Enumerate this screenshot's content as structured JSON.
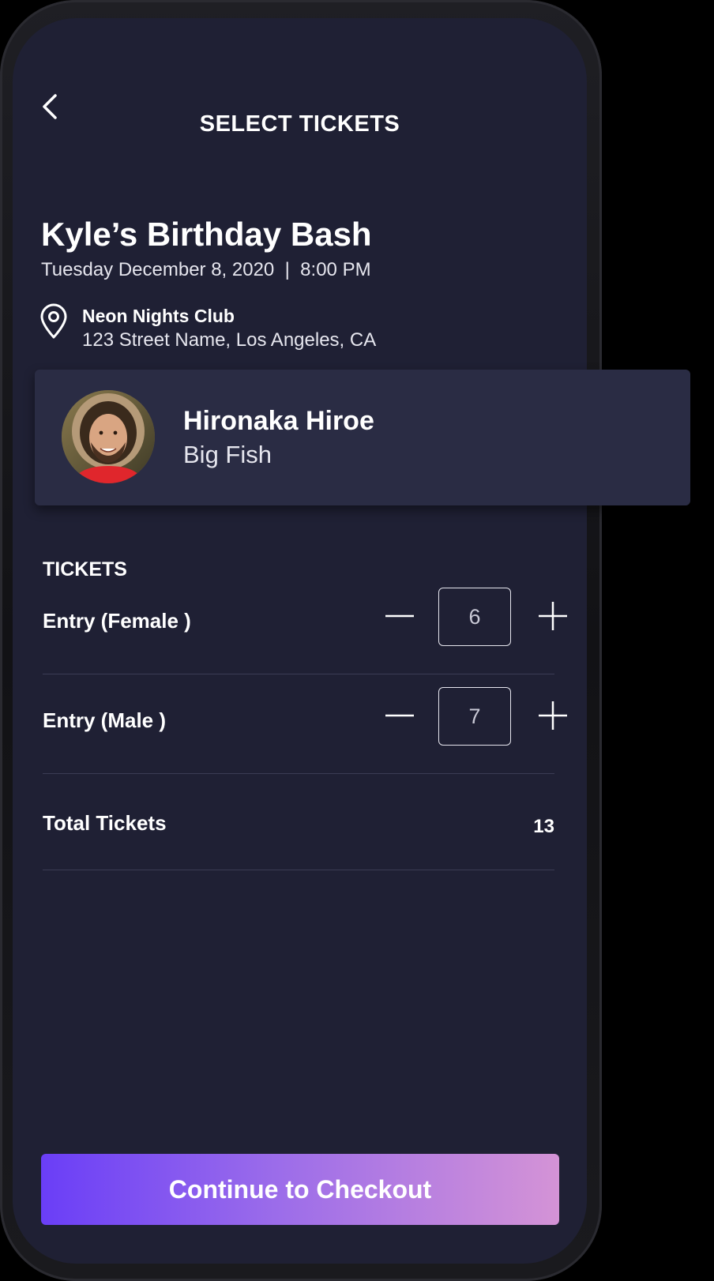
{
  "header": {
    "title": "SELECT TICKETS"
  },
  "event": {
    "title": "Kyle’s Birthday Bash",
    "date": "Tuesday December 8, 2020  |  8:00 PM",
    "venue_name": "Neon Nights Club",
    "venue_address": "123 Street Name, Los Angeles, CA"
  },
  "host": {
    "name": "Hironaka Hiroe",
    "subtitle": "Big Fish"
  },
  "tickets": {
    "section_label": "TICKETS",
    "items": [
      {
        "name": "Entry (Female )",
        "quantity": "6"
      },
      {
        "name": "Entry (Male )",
        "quantity": "7"
      }
    ],
    "total_label": "Total Tickets",
    "total_value": "13"
  },
  "checkout": {
    "label": "Continue to Checkout"
  },
  "icons": {
    "back": "chevron-left-icon",
    "location": "map-pin-icon",
    "minus": "minus-icon",
    "plus": "plus-icon"
  },
  "colors": {
    "screen_bg": "#1f2034",
    "card_bg": "#2a2c44",
    "gradient_start": "#6a3ef7",
    "gradient_end": "#d493d6"
  }
}
